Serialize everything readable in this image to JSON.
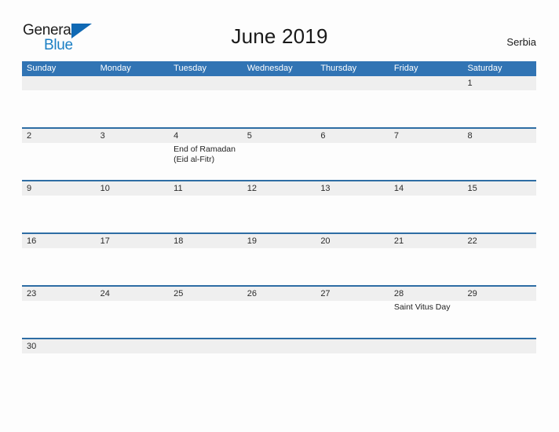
{
  "brand": {
    "name_part1": "General",
    "name_part2": "Blue",
    "flag_icon": "blue-triangle-flag"
  },
  "header": {
    "title": "June 2019",
    "region": "Serbia"
  },
  "colors": {
    "header_blue": "#3174b4",
    "divider_blue": "#2e6da4",
    "band_gray": "#efefef",
    "logo_blue": "#1b7fc4",
    "page_background": "#fdfdfd"
  },
  "calendar": {
    "weekdays": [
      "Sunday",
      "Monday",
      "Tuesday",
      "Wednesday",
      "Thursday",
      "Friday",
      "Saturday"
    ],
    "weeks": [
      {
        "dates": [
          "",
          "",
          "",
          "",
          "",
          "",
          "1"
        ],
        "events": [
          [],
          [],
          [],
          [],
          [],
          [],
          []
        ]
      },
      {
        "dates": [
          "2",
          "3",
          "4",
          "5",
          "6",
          "7",
          "8"
        ],
        "events": [
          [],
          [],
          [
            "End of Ramadan",
            "(Eid al-Fitr)"
          ],
          [],
          [],
          [],
          []
        ]
      },
      {
        "dates": [
          "9",
          "10",
          "11",
          "12",
          "13",
          "14",
          "15"
        ],
        "events": [
          [],
          [],
          [],
          [],
          [],
          [],
          []
        ]
      },
      {
        "dates": [
          "16",
          "17",
          "18",
          "19",
          "20",
          "21",
          "22"
        ],
        "events": [
          [],
          [],
          [],
          [],
          [],
          [],
          []
        ]
      },
      {
        "dates": [
          "23",
          "24",
          "25",
          "26",
          "27",
          "28",
          "29"
        ],
        "events": [
          [],
          [],
          [],
          [],
          [],
          [
            "Saint Vitus Day"
          ],
          []
        ]
      },
      {
        "dates": [
          "30",
          "",
          "",
          "",
          "",
          "",
          ""
        ],
        "events": [
          [],
          [],
          [],
          [],
          [],
          [],
          []
        ]
      }
    ]
  }
}
